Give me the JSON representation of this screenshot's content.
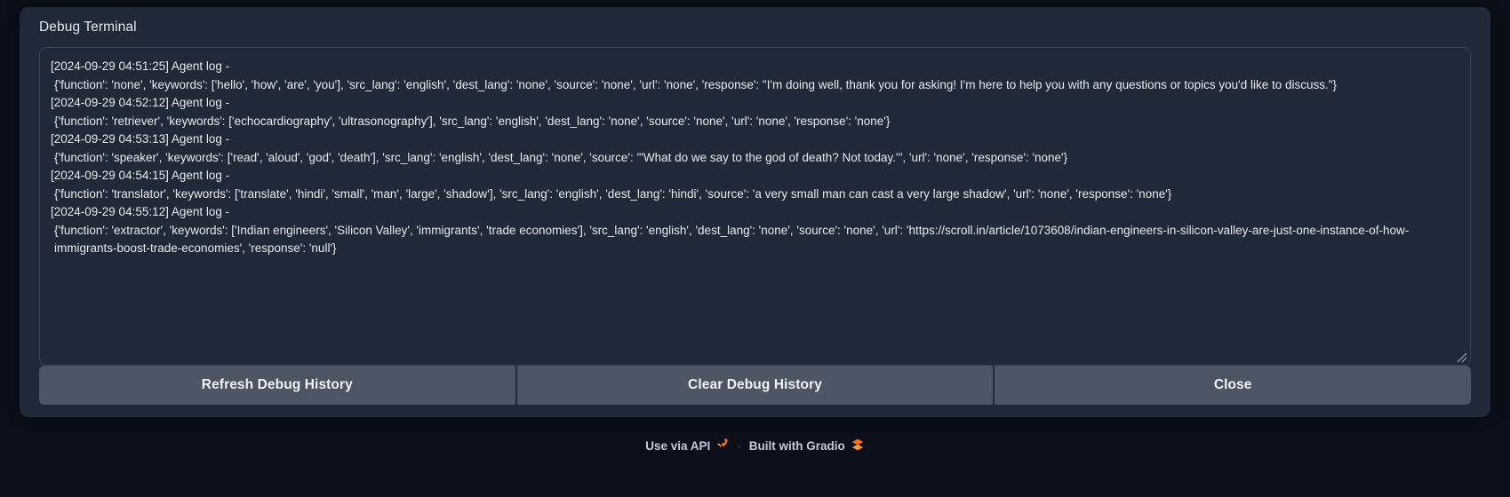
{
  "modal": {
    "title": "Debug Terminal",
    "terminal": {
      "entries": [
        {
          "header": "[2024-09-29 04:51:25] Agent log -",
          "body": "{'function': 'none', 'keywords': ['hello', 'how', 'are', 'you'], 'src_lang': 'english', 'dest_lang': 'none', 'source': 'none', 'url': 'none', 'response': \"I'm doing well, thank you for asking! I'm here to help you with any questions or topics you'd like to discuss.\"}"
        },
        {
          "header": "[2024-09-29 04:52:12] Agent log -",
          "body": "{'function': 'retriever', 'keywords': ['echocardiography', 'ultrasonography'], 'src_lang': 'english', 'dest_lang': 'none', 'source': 'none', 'url': 'none', 'response': 'none'}"
        },
        {
          "header": "[2024-09-29 04:53:13] Agent log -",
          "body": "{'function': 'speaker', 'keywords': ['read', 'aloud', 'god', 'death'], 'src_lang': 'english', 'dest_lang': 'none', 'source': '\"What do we say to the god of death? Not today.\"', 'url': 'none', 'response': 'none'}"
        },
        {
          "header": "[2024-09-29 04:54:15] Agent log -",
          "body": "{'function': 'translator', 'keywords': ['translate', 'hindi', 'small', 'man', 'large', 'shadow'], 'src_lang': 'english', 'dest_lang': 'hindi', 'source': 'a very small man can cast a very large shadow', 'url': 'none', 'response': 'none'}"
        },
        {
          "header": "[2024-09-29 04:55:12] Agent log -",
          "body": "{'function': 'extractor', 'keywords': ['Indian engineers', 'Silicon Valley', 'immigrants', 'trade economies'], 'src_lang': 'english', 'dest_lang': 'none', 'source': 'none', 'url': 'https://scroll.in/article/1073608/indian-engineers-in-silicon-valley-are-just-one-instance-of-how-immigrants-boost-trade-economies', 'response': 'null'}"
        }
      ]
    },
    "buttons": {
      "refresh": "Refresh Debug History",
      "clear": "Clear Debug History",
      "close": "Close"
    }
  },
  "footer": {
    "api_label": "Use via API",
    "api_icon": "rocket-icon",
    "separator": "·",
    "built_label": "Built with Gradio",
    "gradio_icon": "gradio-logo-icon"
  },
  "colors": {
    "page_bg": "#0b0f19",
    "modal_bg": "#1f2937",
    "terminal_border": "#374151",
    "button_bg": "#4b5563",
    "text": "#e8eaed",
    "footer_text": "#c4cbd6",
    "accent_orange": "#f97316"
  }
}
